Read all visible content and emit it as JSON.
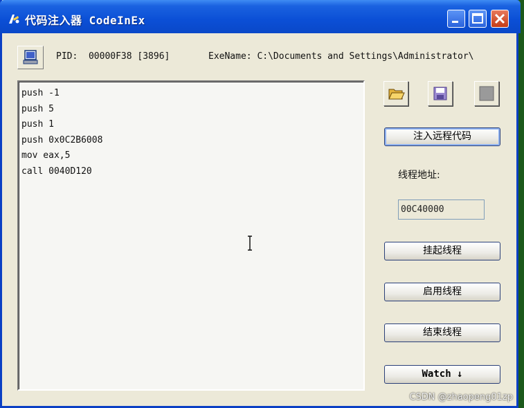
{
  "window": {
    "title": "代码注入器 CodeInEx"
  },
  "process": {
    "pid_text": "PID:  00000F38 [3896]",
    "exe_text": "ExeName: C:\\Documents and Settings\\Administrator\\"
  },
  "code_lines": [
    "push -1",
    "push 5",
    "push 1",
    "push 0x0C2B6008",
    "mov eax,5",
    "call 0040D120"
  ],
  "buttons": {
    "inject": "注入远程代码",
    "suspend": "挂起线程",
    "resume": "启用线程",
    "terminate": "结束线程",
    "watch": "Watch ↓"
  },
  "thread": {
    "label": "线程地址:",
    "address": "00C40000"
  },
  "watermark": "CSDN @zhaopeng01zp",
  "colors": {
    "titlebar": "#0b4fd6",
    "window_bg": "#ece9d8",
    "code_bg": "#f6f6f3"
  }
}
